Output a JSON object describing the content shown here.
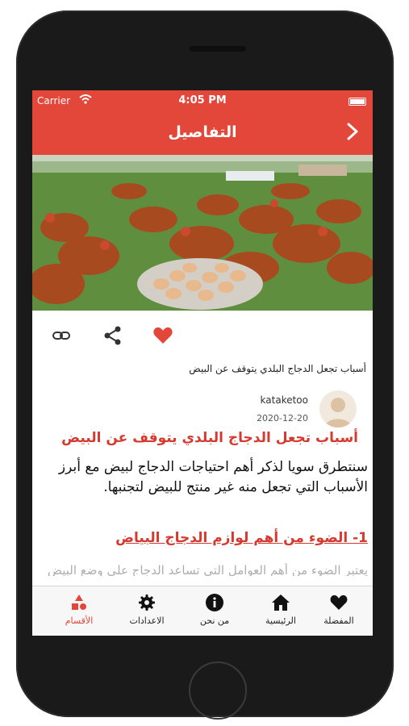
{
  "status_bar": {
    "carrier": "Carrier",
    "time": "4:05 PM"
  },
  "nav": {
    "title": "التفاصيل"
  },
  "hero": {
    "image_alt": ""
  },
  "actions": {
    "icons": [
      "link-icon",
      "share-icon",
      "heart-icon"
    ]
  },
  "article": {
    "subtitle": "أسباب تجعل الدجاج البلدي يتوقف عن البيض",
    "author": "kataketoo",
    "date": "2020-12-20",
    "title": "أسباب تجعل الدجاج البلدي يتوقف عن البيض",
    "intro": "سنتطرق سويا لذكر أهم احتياجات الدجاج لبيض مع أبرز الأسباب التي تجعل منه غير منتج للبيض لتجنبها.",
    "section1": "1- الضوء من أهم لوازم الدجاج البياض",
    "section1_preview": "يعتبر الضوء من أهم العوامل التي تساعد الدجاج على وضع البيض"
  },
  "tabbar": {
    "items": [
      {
        "label": "الأقسام",
        "icon": "categories-icon",
        "active": true
      },
      {
        "label": "الاعدادات",
        "icon": "settings-icon",
        "active": false
      },
      {
        "label": "من نحن",
        "icon": "info-icon",
        "active": false
      },
      {
        "label": "الرئيسية",
        "icon": "home-icon",
        "active": false
      },
      {
        "label": "المفضلة",
        "icon": "heart-icon",
        "active": false
      }
    ]
  },
  "colors": {
    "accent": "#e2473a",
    "title_red": "#d63a2f"
  }
}
